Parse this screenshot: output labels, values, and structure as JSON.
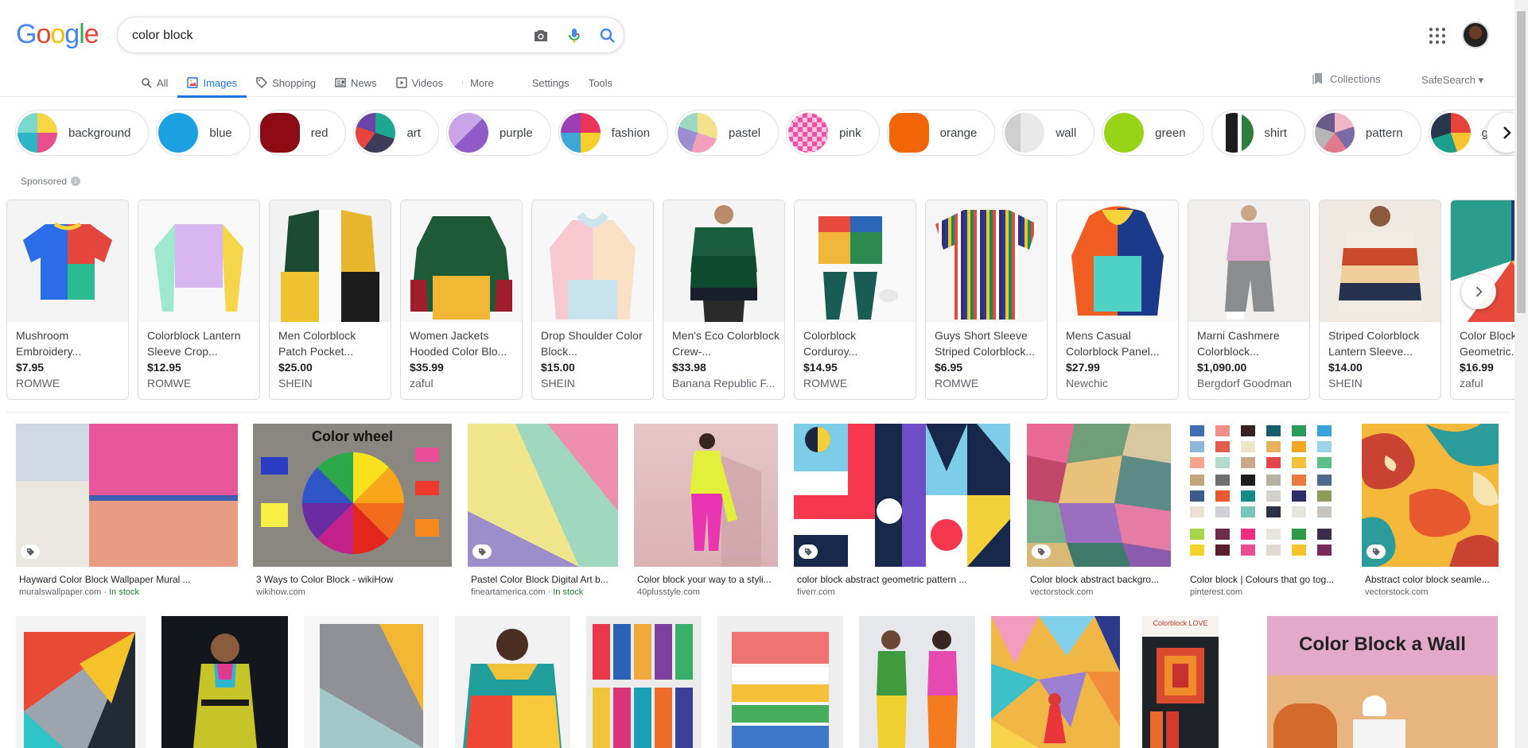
{
  "header": {
    "logo": "Google",
    "search_query": "color block",
    "tabs": [
      {
        "label": "All",
        "icon": "search-icon"
      },
      {
        "label": "Images",
        "icon": "image-icon",
        "active": true
      },
      {
        "label": "Shopping",
        "icon": "tag-icon"
      },
      {
        "label": "News",
        "icon": "news-icon"
      },
      {
        "label": "Videos",
        "icon": "play-icon"
      },
      {
        "label": "More",
        "icon": "more-vert-icon"
      }
    ],
    "settings_label": "Settings",
    "tools_label": "Tools",
    "collections_label": "Collections",
    "safesearch_label": "SafeSearch"
  },
  "chips": [
    {
      "label": "background"
    },
    {
      "label": "blue"
    },
    {
      "label": "red"
    },
    {
      "label": "art"
    },
    {
      "label": "purple"
    },
    {
      "label": "fashion"
    },
    {
      "label": "pastel"
    },
    {
      "label": "pink"
    },
    {
      "label": "orange"
    },
    {
      "label": "wall"
    },
    {
      "label": "green"
    },
    {
      "label": "shirt"
    },
    {
      "label": "pattern"
    },
    {
      "label": "geometric"
    }
  ],
  "sponsored_label": "Sponsored",
  "products": [
    {
      "title": "Mushroom Embroidery...",
      "price": "$7.95",
      "seller": "ROMWE"
    },
    {
      "title": "Colorblock Lantern Sleeve Crop...",
      "price": "$12.95",
      "seller": "ROMWE"
    },
    {
      "title": "Men Colorblock Patch Pocket...",
      "price": "$25.00",
      "seller": "SHEIN"
    },
    {
      "title": "Women Jackets Hooded Color Blo...",
      "price": "$35.99",
      "seller": "zaful"
    },
    {
      "title": "Drop Shoulder Color Block...",
      "price": "$15.00",
      "seller": "SHEIN"
    },
    {
      "title": "Men's Eco Colorblock Crew-...",
      "price": "$33.98",
      "seller": "Banana Republic F..."
    },
    {
      "title": "Colorblock Corduroy...",
      "price": "$14.95",
      "seller": "ROMWE"
    },
    {
      "title": "Guys Short Sleeve Striped Colorblock...",
      "price": "$6.95",
      "seller": "ROMWE"
    },
    {
      "title": "Mens Casual Colorblock Panel...",
      "price": "$27.99",
      "seller": "Newchic"
    },
    {
      "title": "Marni Cashmere Colorblock...",
      "price": "$1,090.00",
      "seller": "Bergdorf Goodman"
    },
    {
      "title": "Striped Colorblock Lantern Sleeve...",
      "price": "$14.00",
      "seller": "SHEIN"
    },
    {
      "title": "Color Block Geometric...",
      "price": "$16.99",
      "seller": "zaful"
    }
  ],
  "results": [
    {
      "title": "Hayward Color Block Wallpaper Mural ...",
      "source": "muralswallpaper.com",
      "stock": "In stock"
    },
    {
      "title": "3 Ways to Color Block - wikiHow",
      "source": "wikihow.com",
      "image_text": "Color wheel"
    },
    {
      "title": "Pastel Color Block Digital Art b...",
      "source": "fineartamerica.com",
      "stock": "In stock"
    },
    {
      "title": "Color block your way to a styli...",
      "source": "40plusstyle.com"
    },
    {
      "title": "color block abstract geometric pattern ...",
      "source": "fiverr.com"
    },
    {
      "title": "Color block abstract backgro...",
      "source": "vectorstock.com"
    },
    {
      "title": "Color block | Colours that go tog...",
      "source": "pinterest.com"
    },
    {
      "title": "Abstract color block seamle...",
      "source": "vectorstock.com"
    }
  ],
  "row2": {
    "wall_image_text": "Color Block a Wall",
    "book_cover_text": "Colorblock LOVE"
  }
}
